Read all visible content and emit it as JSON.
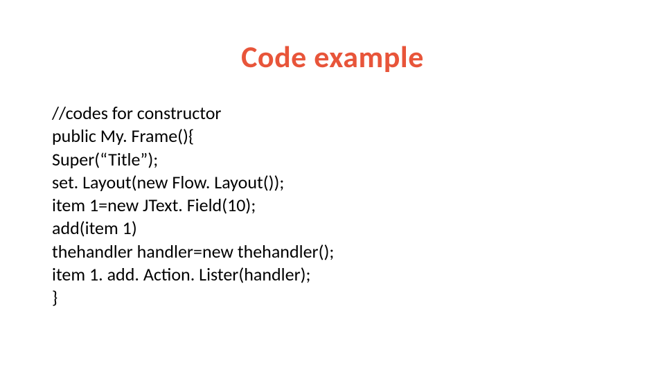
{
  "title": "Code example",
  "code": {
    "line1": "//codes for constructor",
    "line2": "public My. Frame(){",
    "line3": "Super(“Title”);",
    "line4": "set. Layout(new Flow. Layout());",
    "line5": "item 1=new JText. Field(10);",
    "line6": "add(item 1)",
    "line7": "thehandler handler=new thehandler();",
    "line8": "item 1. add. Action. Lister(handler);",
    "line9": "}"
  }
}
